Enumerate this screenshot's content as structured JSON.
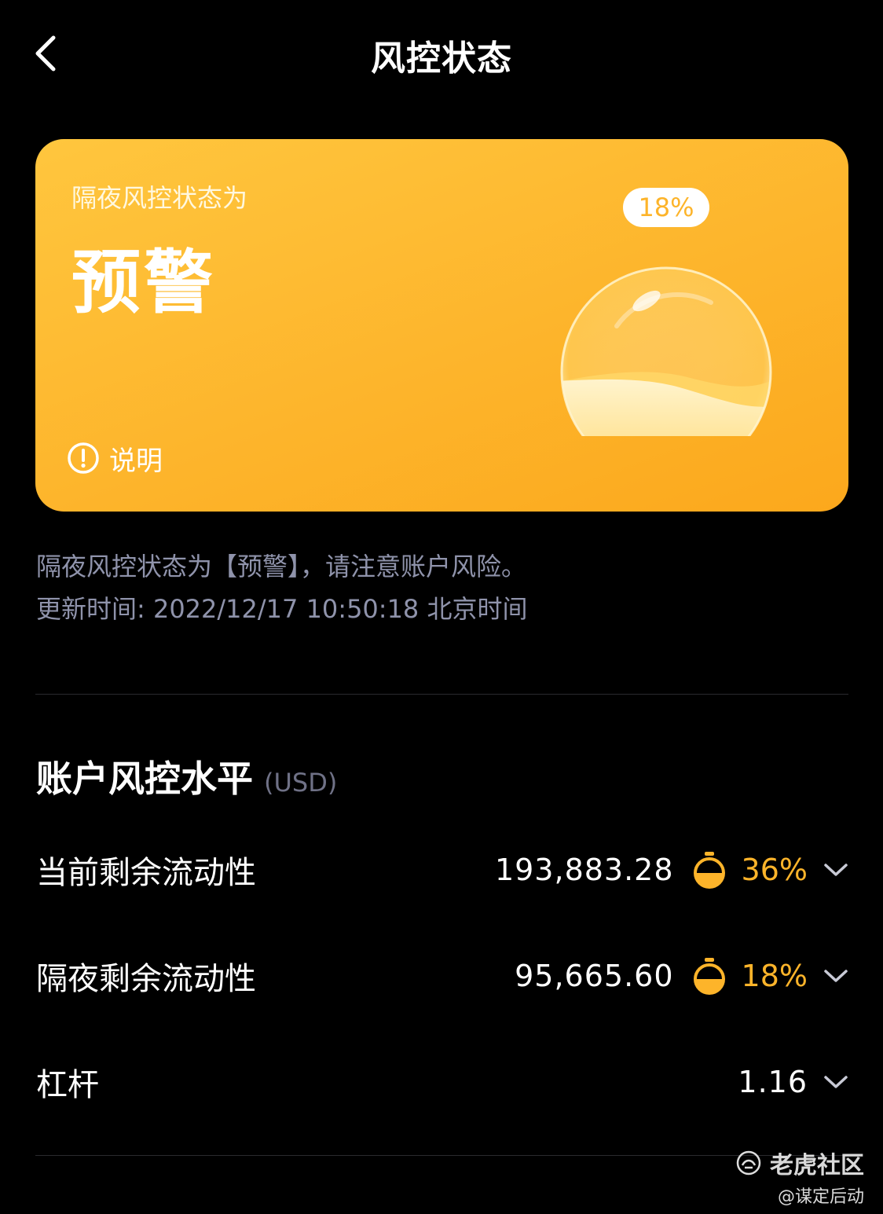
{
  "header": {
    "title": "风控状态"
  },
  "card": {
    "subtitle": "隔夜风控状态为",
    "status": "预警",
    "help_label": "说明",
    "gauge_percent": "18%",
    "gauge_fill": 0.18,
    "accent": "#fdb42a"
  },
  "notice": {
    "text": "隔夜风控状态为【预警】，请注意账户风险。",
    "updated": "更新时间: 2022/12/17 10:50:18 北京时间"
  },
  "section": {
    "title": "账户风控水平",
    "unit": "(USD)"
  },
  "rows": [
    {
      "label": "当前剩余流动性",
      "value": "193,883.28",
      "percent": "36%"
    },
    {
      "label": "隔夜剩余流动性",
      "value": "95,665.60",
      "percent": "18%"
    },
    {
      "label": "杠杆",
      "value": "1.16",
      "percent": ""
    }
  ],
  "watermark": {
    "brand": "老虎社区",
    "user": "@谋定后动"
  }
}
